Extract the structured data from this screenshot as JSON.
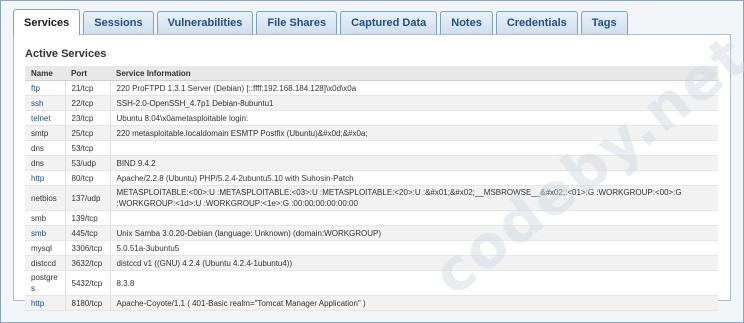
{
  "tabs": [
    {
      "label": "Services",
      "active": true
    },
    {
      "label": "Sessions",
      "active": false
    },
    {
      "label": "Vulnerabilities",
      "active": false
    },
    {
      "label": "File Shares",
      "active": false
    },
    {
      "label": "Captured Data",
      "active": false
    },
    {
      "label": "Notes",
      "active": false
    },
    {
      "label": "Credentials",
      "active": false
    },
    {
      "label": "Tags",
      "active": false
    }
  ],
  "section_title": "Active Services",
  "columns": {
    "name": "Name",
    "port": "Port",
    "info": "Service Information"
  },
  "rows": [
    {
      "name": "ftp",
      "port": "21/tcp",
      "info": "220 ProFTPD 1.3.1 Server (Debian) [::ffff:192.168.184.128]\\x0d\\x0a",
      "link": true
    },
    {
      "name": "ssh",
      "port": "22/tcp",
      "info": "SSH-2.0-OpenSSH_4.7p1 Debian-8ubuntu1",
      "link": true
    },
    {
      "name": "telnet",
      "port": "23/tcp",
      "info": "Ubuntu 8.04\\x0ametasploitable login:",
      "link": true
    },
    {
      "name": "smtp",
      "port": "25/tcp",
      "info": "220 metasploitable.localdomain ESMTP Postfix (Ubuntu)&#x0d;&#x0a;",
      "link": false
    },
    {
      "name": "dns",
      "port": "53/tcp",
      "info": "",
      "link": false
    },
    {
      "name": "dns",
      "port": "53/udp",
      "info": "BIND 9.4.2",
      "link": false
    },
    {
      "name": "http",
      "port": "80/tcp",
      "info": "Apache/2.2.8 (Ubuntu) PHP/5.2.4-2ubuntu5.10 with Suhosin-Patch",
      "link": true
    },
    {
      "name": "netbios",
      "port": "137/udp",
      "info": "METASPLOITABLE:<00>:U :METASPLOITABLE:<03>:U :METASPLOITABLE:<20>:U :&#x01;&#x02;__MSBROWSE__&#x02;:<01>:G :WORKGROUP:<00>:G :WORKGROUP:<1d>:U :WORKGROUP:<1e>:G :00:00:00:00:00:00",
      "link": false
    },
    {
      "name": "smb",
      "port": "139/tcp",
      "info": "",
      "link": false
    },
    {
      "name": "smb",
      "port": "445/tcp",
      "info": "Unix Samba 3.0.20-Debian (language: Unknown) (domain:WORKGROUP)",
      "link": true
    },
    {
      "name": "mysql",
      "port": "3306/tcp",
      "info": "5.0.51a-3ubuntu5",
      "link": false
    },
    {
      "name": "distccd",
      "port": "3632/tcp",
      "info": "distccd v1 ((GNU) 4.2.4 (Ubuntu 4.2.4-1ubuntu4))",
      "link": false
    },
    {
      "name": "postgres",
      "port": "5432/tcp",
      "info": "8.3.8",
      "link": false
    },
    {
      "name": "http",
      "port": "8180/tcp",
      "info": "Apache-Coyote/1.1 ( 401-Basic realm=\"Tomcat Manager Application\" )",
      "link": true
    }
  ],
  "watermark": "codeby.net",
  "colors": {
    "tab_text": "#1f4f80",
    "border": "#7ea2c4",
    "link": "#1f4f80"
  }
}
